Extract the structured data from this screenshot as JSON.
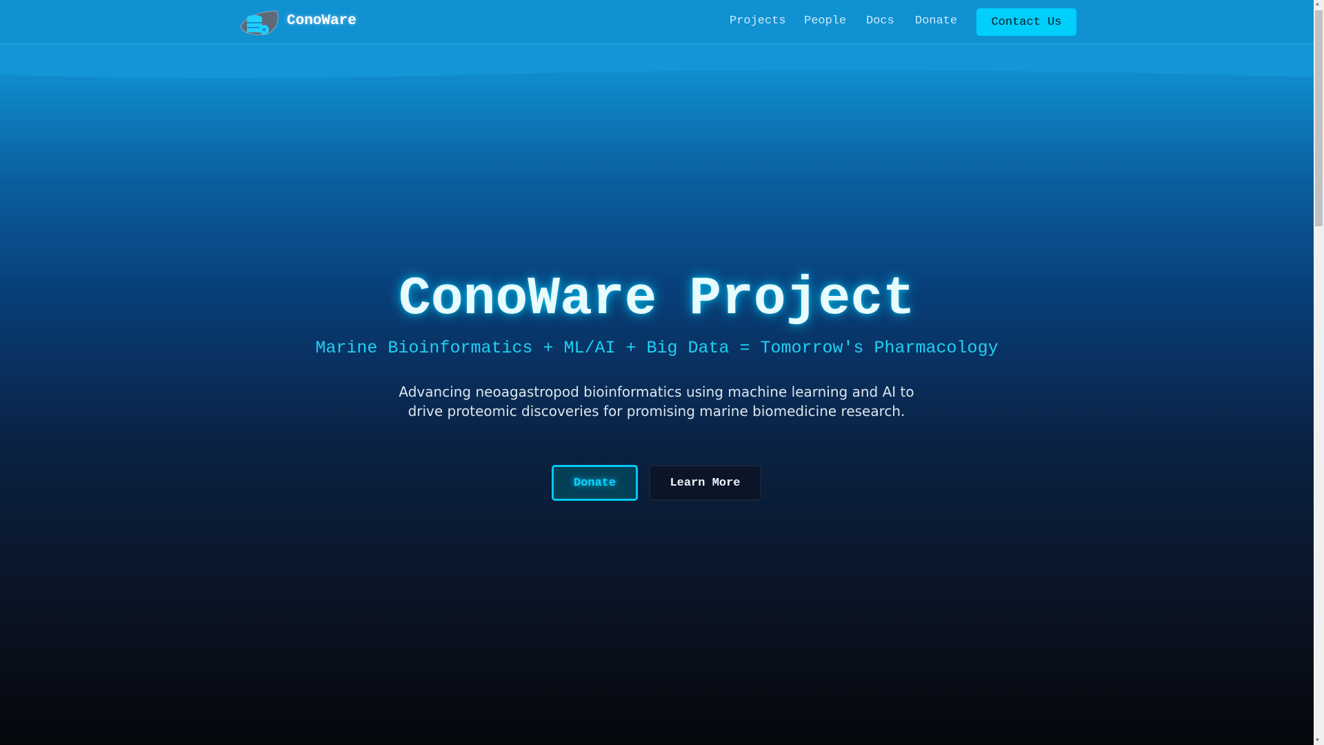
{
  "header": {
    "brand": "ConoWare",
    "nav": [
      "Projects",
      "People",
      "Docs",
      "Donate"
    ],
    "contact_label": "Contact Us"
  },
  "hero": {
    "title": "ConoWare Project",
    "subtitle": "Marine Bioinformatics + ML/AI + Big Data = Tomorrow's Pharmacology",
    "description": "Advancing neoagastropod bioinformatics using machine learning and AI to drive proteomic discoveries for promising marine biomedicine research.",
    "donate_label": "Donate",
    "learn_more_label": "Learn More"
  },
  "colors": {
    "accent": "#00cffc",
    "header": "#0f91d2"
  }
}
